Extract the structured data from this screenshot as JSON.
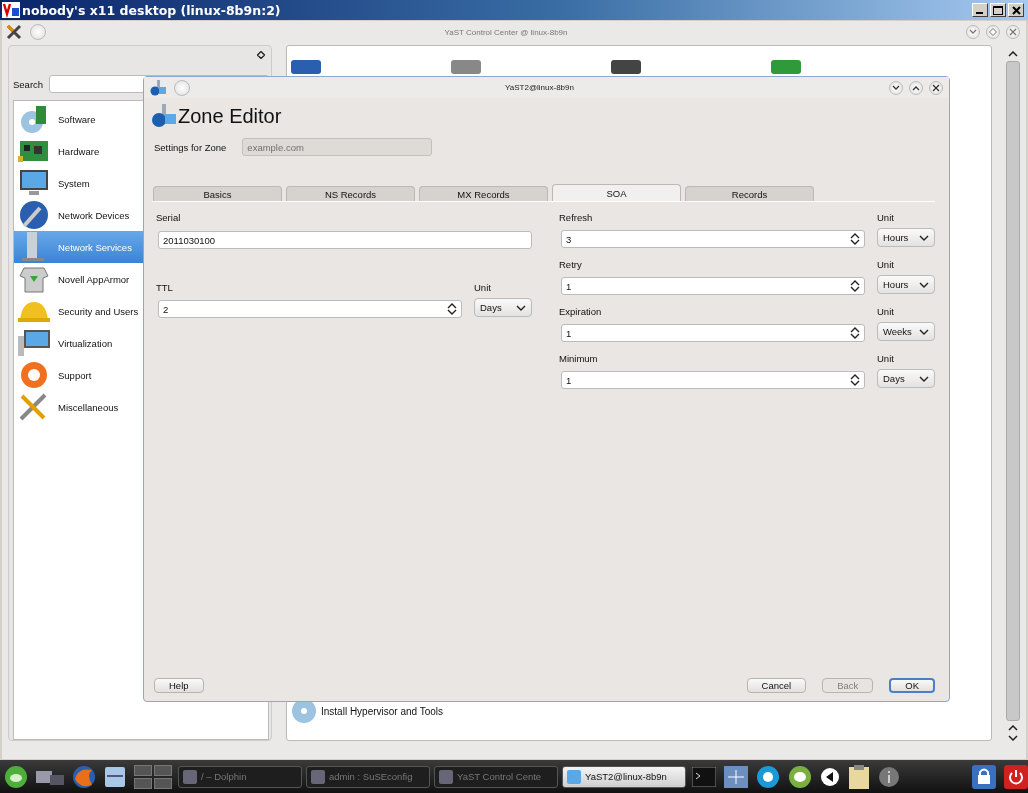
{
  "desktop": {
    "title": "nobody's x11 desktop (linux-8b9n:2)"
  },
  "control_center": {
    "title": "YaST Control Center @ linux-8b9n",
    "search": {
      "label": "Search"
    },
    "categories": [
      {
        "label": "Software",
        "selected": false
      },
      {
        "label": "Hardware",
        "selected": false
      },
      {
        "label": "System",
        "selected": false
      },
      {
        "label": "Network Devices",
        "selected": false
      },
      {
        "label": "Network Services",
        "selected": true
      },
      {
        "label": "Novell AppArmor",
        "selected": false
      },
      {
        "label": "Security and Users",
        "selected": false
      },
      {
        "label": "Virtualization",
        "selected": false
      },
      {
        "label": "Support",
        "selected": false
      },
      {
        "label": "Miscellaneous",
        "selected": false
      }
    ],
    "bottom_module": {
      "label": "Install Hypervisor and Tools"
    }
  },
  "dialog": {
    "title": "YaST2@linux-8b9n",
    "heading": "Zone Editor",
    "zone": {
      "label": "Settings for Zone",
      "value": "example.com",
      "disabled": true
    },
    "tabs": [
      {
        "label": "Basics",
        "selected": false
      },
      {
        "label": "NS Records",
        "selected": false
      },
      {
        "label": "MX Records",
        "selected": false
      },
      {
        "label": "SOA",
        "selected": true
      },
      {
        "label": "Records",
        "selected": false
      }
    ],
    "serial": {
      "label": "Serial",
      "value": "2011030100"
    },
    "ttl": {
      "label": "TTL",
      "value": "2",
      "unit_label": "Unit",
      "unit": "Days"
    },
    "timers": [
      {
        "label": "Refresh",
        "value": "3",
        "unit_label": "Unit",
        "unit": "Hours"
      },
      {
        "label": "Retry",
        "value": "1",
        "unit_label": "Unit",
        "unit": "Hours"
      },
      {
        "label": "Expiration",
        "value": "1",
        "unit_label": "Unit",
        "unit": "Weeks"
      },
      {
        "label": "Minimum",
        "value": "1",
        "unit_label": "Unit",
        "unit": "Days"
      }
    ],
    "buttons": [
      {
        "label": "Help",
        "disabled": false,
        "default": false
      },
      {
        "label": "Cancel",
        "disabled": false,
        "default": false
      },
      {
        "label": "Back",
        "disabled": true,
        "default": false
      },
      {
        "label": "OK",
        "disabled": false,
        "default": true
      }
    ]
  },
  "taskbar": {
    "tasks": [
      {
        "label": "/ – Dolphin",
        "selected": false
      },
      {
        "label": "admin : SuSEconfig",
        "selected": false
      },
      {
        "label": "YaST Control Cente",
        "selected": false
      },
      {
        "label": "YaST2@linux-8b9n",
        "selected": true
      }
    ]
  }
}
